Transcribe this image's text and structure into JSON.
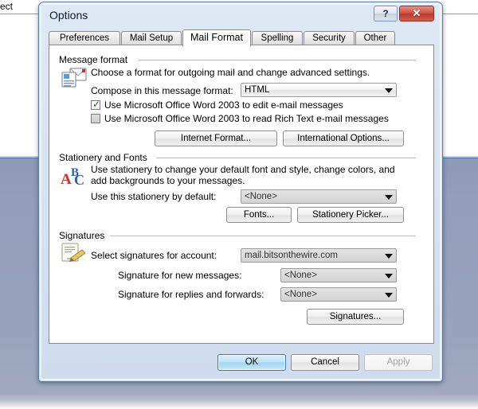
{
  "background": {
    "partial_subject_text": "ect",
    "desktop_accent": "#939eba"
  },
  "dialog": {
    "title": "Options",
    "titlebar_buttons": [
      {
        "name": "help",
        "glyph": "?"
      },
      {
        "name": "close",
        "glyph": "✕"
      }
    ],
    "tabs": [
      {
        "label": "Preferences",
        "active": false
      },
      {
        "label": "Mail Setup",
        "active": false
      },
      {
        "label": "Mail Format",
        "active": true
      },
      {
        "label": "Spelling",
        "active": false
      },
      {
        "label": "Security",
        "active": false
      },
      {
        "label": "Other",
        "active": false
      }
    ],
    "groups": {
      "message_format": {
        "title": "Message format",
        "icon": "mail-format-icon",
        "description": "Choose a format for outgoing mail and change advanced settings.",
        "compose_label": "Compose in this message format:",
        "compose_value": "HTML",
        "checkbox_edit": {
          "label": "Use Microsoft Office Word 2003 to edit e-mail messages",
          "checked": true
        },
        "checkbox_read": {
          "label": "Use Microsoft Office Word 2003 to read Rich Text e-mail messages",
          "checked": false
        },
        "button_internet_format": "Internet Format...",
        "button_international_options": "International Options..."
      },
      "stationery_and_fonts": {
        "title": "Stationery and Fonts",
        "icon": "abc-stationery-icon",
        "description": "Use stationery to change your default font and style, change colors, and add backgrounds to your messages.",
        "stationery_label": "Use this stationery by default:",
        "stationery_value": "<None>",
        "stationery_disabled": true,
        "button_fonts": "Fonts...",
        "button_stationery_picker": "Stationery Picker..."
      },
      "signatures": {
        "title": "Signatures",
        "icon": "signature-pen-icon",
        "account_label": "Select signatures for account:",
        "account_value": "mail.bitsonthewire.com",
        "new_messages_label": "Signature for new messages:",
        "new_messages_value": "<None>",
        "replies_label": "Signature for replies and forwards:",
        "replies_value": "<None>",
        "button_signatures": "Signatures..."
      }
    },
    "footer": {
      "ok": "OK",
      "cancel": "Cancel",
      "apply": "Apply",
      "ok_is_default": true,
      "apply_disabled": true
    }
  }
}
